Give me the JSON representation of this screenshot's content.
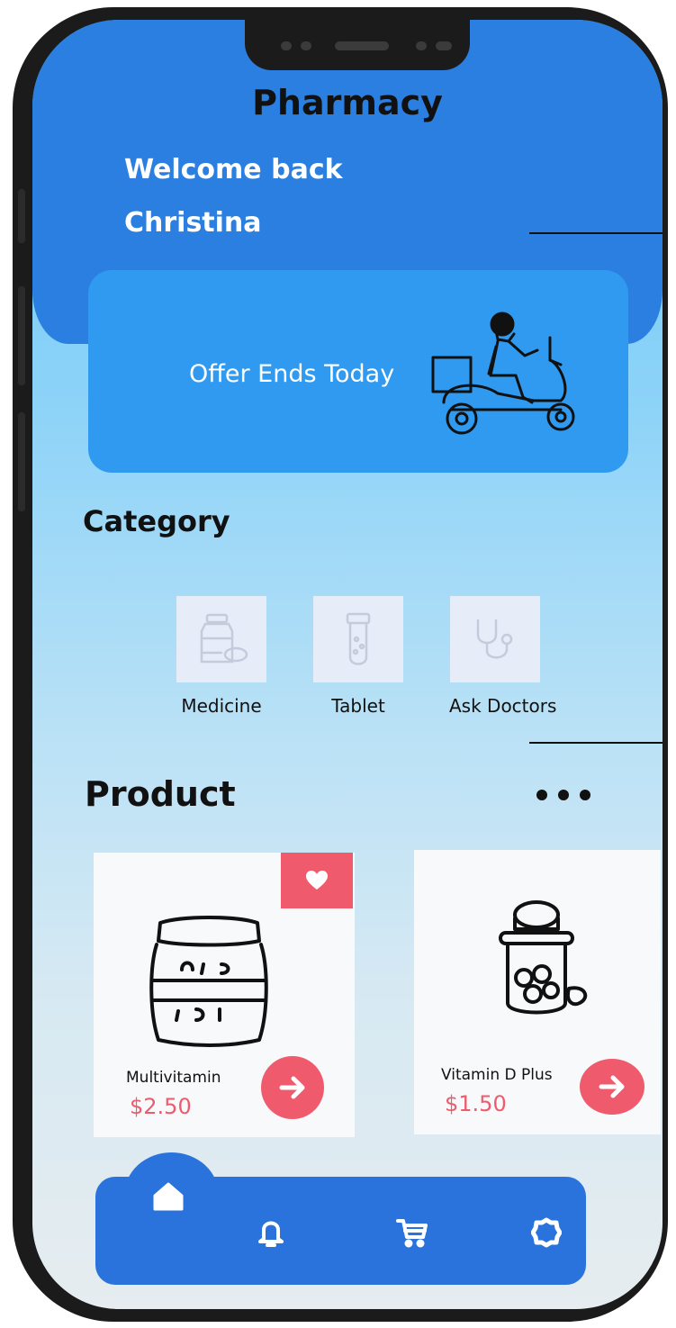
{
  "app": {
    "title": "Pharmacy"
  },
  "greeting": {
    "welcome": "Welcome back",
    "user_name": "Christina"
  },
  "banner": {
    "text": "Offer Ends Today",
    "illustration": "delivery-scooter"
  },
  "category": {
    "title": "Category",
    "items": [
      {
        "label": "Medicine",
        "icon": "medicine-bottle-icon"
      },
      {
        "label": "Tablet",
        "icon": "test-tube-icon"
      },
      {
        "label": "Ask Doctors",
        "icon": "stethoscope-icon"
      }
    ]
  },
  "products": {
    "title": "Product",
    "more_icon": "more-dots-icon",
    "items": [
      {
        "name": "Multivitamin",
        "price": "$2.50",
        "favorite": true
      },
      {
        "name": "Vitamin D Plus",
        "price": "$1.50",
        "favorite": false
      }
    ]
  },
  "bottom_nav": {
    "items": [
      "home-icon",
      "bell-icon",
      "cart-icon",
      "settings-icon"
    ],
    "active": "home-icon"
  },
  "colors": {
    "header_blue": "#2a7fe0",
    "banner_blue": "#2f9af0",
    "accent_red": "#ef5b6c",
    "nav_blue": "#2a73dc"
  }
}
